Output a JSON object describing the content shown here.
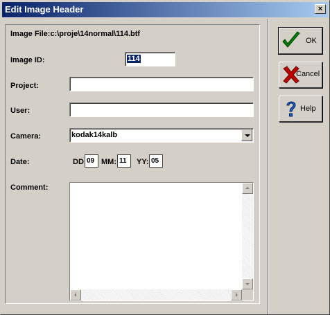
{
  "window": {
    "title": "Edit Image Header",
    "close_glyph": "×"
  },
  "fields": {
    "image_file_label": "Image File:c:\\proje\\14normal\\114.btf",
    "image_id_label": "Image ID:",
    "image_id_value": "114",
    "project_label": "Project:",
    "project_value": "",
    "user_label": "User:",
    "user_value": "",
    "camera_label": "Camera:",
    "camera_value": "kodak14kalb",
    "date_label": "Date:",
    "dd_label": "DD:",
    "dd_value": "09",
    "mm_label": "MM:",
    "mm_value": "11",
    "yy_label": "YY:",
    "yy_value": "05",
    "comment_label": "Comment:",
    "comment_value": ""
  },
  "buttons": {
    "ok_label": "OK",
    "cancel_label": "Cancel",
    "help_label": "Help"
  },
  "icons": {
    "ok": "checkmark-icon",
    "cancel": "x-mark-icon",
    "help": "question-mark-icon"
  },
  "colors": {
    "face": "#d4d0c8",
    "title_start": "#0a246a",
    "title_end": "#a6caf0",
    "ok_check": "#008000",
    "cancel_x": "#c00000",
    "help_mark": "#2060c0"
  }
}
